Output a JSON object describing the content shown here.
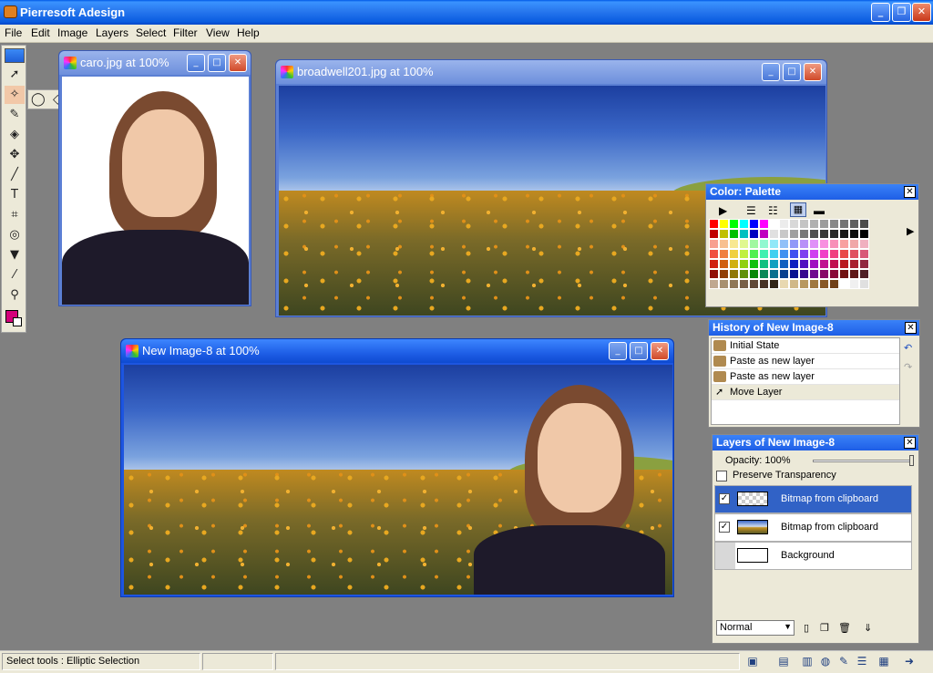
{
  "app": {
    "title": "Pierresoft Adesign"
  },
  "menu": [
    "File",
    "Edit",
    "Image",
    "Layers",
    "Select",
    "Filter",
    "View",
    "Help"
  ],
  "windows": {
    "caro": {
      "title": "caro.jpg at 100%"
    },
    "broadwell": {
      "title": "broadwell201.jpg at 100%"
    },
    "newimage": {
      "title": "New Image-8 at 100%"
    }
  },
  "palette": {
    "title": "Color: Palette",
    "colors": [
      "#ff0000",
      "#ffff00",
      "#00ff00",
      "#00ffff",
      "#0000ff",
      "#ff00ff",
      "#ffffff",
      "#ececec",
      "#d8d8d8",
      "#c4c4c4",
      "#b0b0b0",
      "#9c9c9c",
      "#888888",
      "#747474",
      "#606060",
      "#4c4c4c",
      "#c00000",
      "#c0c000",
      "#00c000",
      "#00c0c0",
      "#0000c0",
      "#c000c0",
      "#e0e0e0",
      "#c8c8c8",
      "#a0a0a0",
      "#787878",
      "#505050",
      "#383838",
      "#282828",
      "#181818",
      "#0c0c0c",
      "#000000",
      "#f8a090",
      "#f8c090",
      "#f8e890",
      "#e0f890",
      "#a0f8a0",
      "#90f8d0",
      "#90e8f8",
      "#90c0f8",
      "#9098f8",
      "#b890f8",
      "#e090f8",
      "#f890e0",
      "#f890b8",
      "#f8a0a0",
      "#f0a8a8",
      "#f0b0c0",
      "#f05040",
      "#f08040",
      "#f0d040",
      "#c0f040",
      "#50f050",
      "#40f0b0",
      "#40d0f0",
      "#4090f0",
      "#4050f0",
      "#8040f0",
      "#d040f0",
      "#f040c8",
      "#f04080",
      "#e84848",
      "#e05060",
      "#d85878",
      "#d02010",
      "#d06010",
      "#d0b010",
      "#90d010",
      "#10c010",
      "#10c080",
      "#10a0c0",
      "#1060c0",
      "#1020c0",
      "#5010c0",
      "#a010c0",
      "#c01090",
      "#c01050",
      "#b81820",
      "#a82030",
      "#902840",
      "#901008",
      "#904008",
      "#907808",
      "#609008",
      "#088808",
      "#088858",
      "#087090",
      "#084090",
      "#081090",
      "#380890",
      "#700890",
      "#880868",
      "#880838",
      "#701010",
      "#601818",
      "#502028",
      "#c0a890",
      "#a89070",
      "#907858",
      "#786048",
      "#604838",
      "#483428",
      "#302418",
      "#e8d8b0",
      "#d0b888",
      "#b89860",
      "#a07840",
      "#885828",
      "#704018",
      "#ffffff",
      "#f0f0f0",
      "#e0e0e0"
    ]
  },
  "history": {
    "title": "History of New Image-8",
    "items": [
      "Initial State",
      "Paste as new layer",
      "Paste as new layer",
      "Move Layer"
    ]
  },
  "layers": {
    "title": "Layers of New Image-8",
    "opacity_label": "Opacity: 100%",
    "opacity": 1.0,
    "preserve_transparency": "Preserve Transparency",
    "items": [
      {
        "name": "Bitmap from clipboard",
        "visible": true,
        "selected": true
      },
      {
        "name": "Bitmap from clipboard",
        "visible": true,
        "selected": false
      },
      {
        "name": "Background",
        "visible": false,
        "selected": false
      }
    ],
    "blend_mode": "Normal"
  },
  "status": {
    "text": "Select tools : Elliptic Selection"
  },
  "colors": {
    "foreground": "#d4007a",
    "background": "#ffffff",
    "titlebar": "#1e5ee6"
  }
}
